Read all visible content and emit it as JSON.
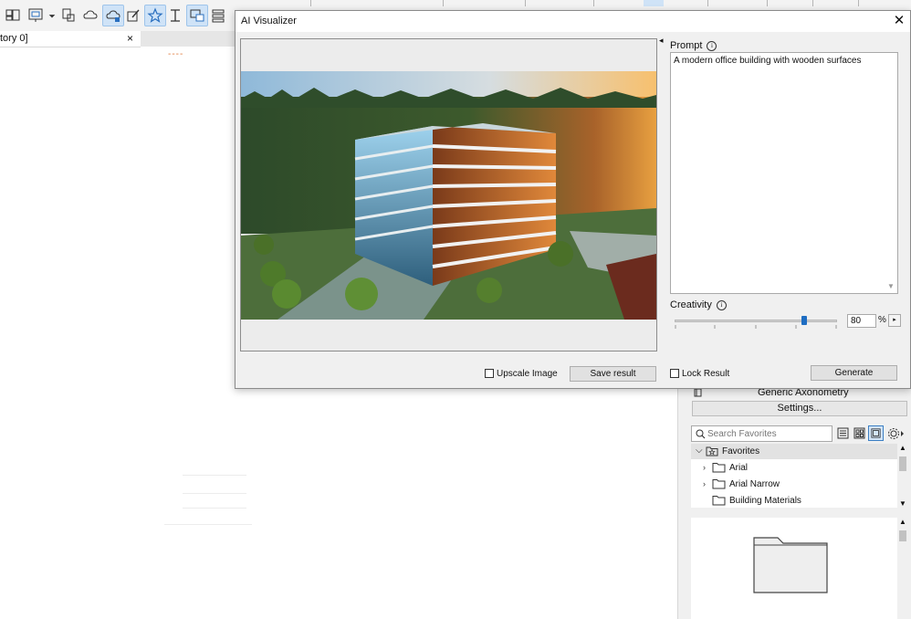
{
  "app": {
    "tab_label": "tory 0]",
    "tab_close": "×",
    "ruler_mark": "----",
    "toolbar_icons": [
      "floor-plan-icon",
      "layout-icon",
      "dropdown-icon",
      "publish-icon",
      "cloud-icon",
      "cloud-active-icon",
      "edit-icon",
      "favorites-star-icon",
      "text-cursor-icon",
      "window-icon",
      "stack-icon"
    ]
  },
  "dialog": {
    "title": "AI Visualizer",
    "close": "✕",
    "collapse": "◂",
    "prompt_label": "Prompt",
    "info_glyph": "i",
    "prompt_value": "A modern office building with wooden surfaces",
    "creativity_label": "Creativity",
    "creativity_value": "80",
    "creativity_level": 0.8,
    "percent_sign": "%",
    "value_arrow": "▸",
    "upscale_label": "Upscale Image",
    "save_label": "Save result",
    "lock_label": "Lock Result",
    "generate_label": "Generate"
  },
  "palette": {
    "view_name": "Generic Axonometry",
    "settings_label": "Settings...",
    "search_placeholder": "Search Favorites",
    "favorites_header": "Favorites",
    "items": [
      {
        "label": "Arial",
        "expandable": true
      },
      {
        "label": "Arial Narrow",
        "expandable": true
      },
      {
        "label": "Building Materials",
        "expandable": false
      }
    ]
  },
  "colors": {
    "accent": "#1e6dc2",
    "dialog_bg": "#f0f0f0",
    "selection": "#cfe3f7"
  }
}
